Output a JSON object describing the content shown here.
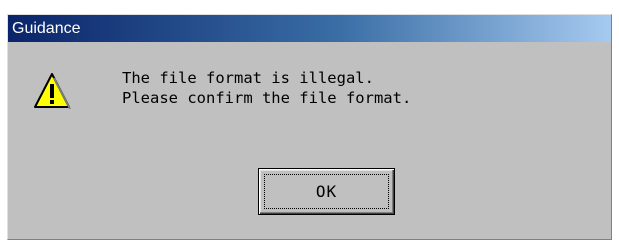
{
  "dialog": {
    "title": "Guidance",
    "icon": "warning-icon",
    "message_lines": [
      "The file format is illegal.",
      "Please confirm the file format."
    ],
    "ok_label": "OK"
  },
  "colors": {
    "dialog_bg": "#c0c0c0",
    "title_bar_start": "#0a246a",
    "title_bar_end": "#a6caf0",
    "title_text": "#ffffff",
    "icon_fill": "#ffff00"
  }
}
